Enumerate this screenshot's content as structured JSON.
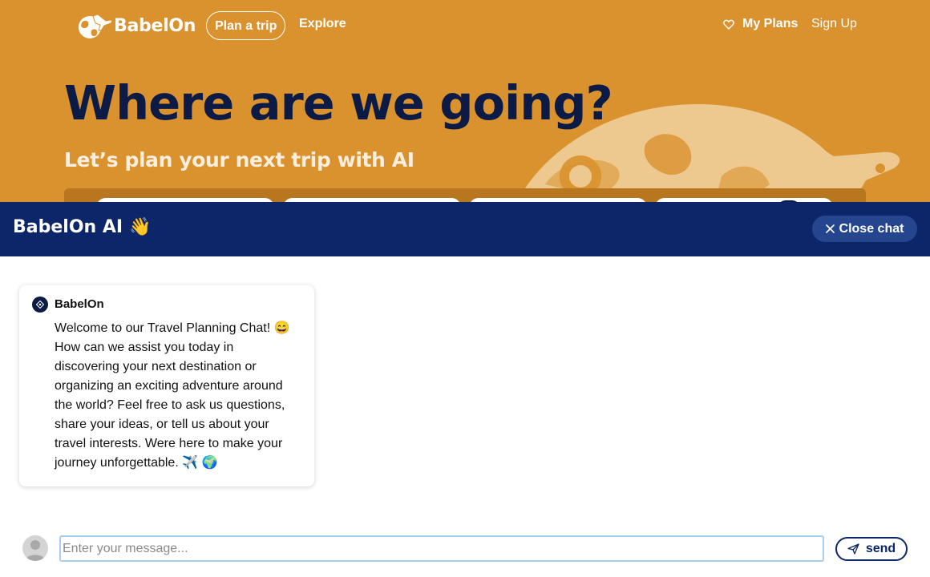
{
  "nav": {
    "brand": "BabelOn",
    "plan_trip": "Plan a trip",
    "explore": "Explore",
    "my_plans": "My Plans",
    "sign_up": "Sign Up"
  },
  "hero": {
    "title": "Where are we going?",
    "subtitle": "Let’s plan your next trip with AI"
  },
  "chat": {
    "title": "BabelOn AI",
    "title_emoji": "👋",
    "close_label": "Close chat",
    "messages": [
      {
        "sender": "BabelOn",
        "text": "Welcome to our Travel Planning Chat! 😄 How can we assist you today in discovering your next destination or organizing an exciting adventure around the world? Feel free to ask us questions, share your ideas, or tell us about your travel interests. Were here to make your journey unforgettable. ✈️ 🌍"
      }
    ],
    "input_placeholder": "Enter your message...",
    "send_label": "send"
  },
  "colors": {
    "hero_bg": "#d9922e",
    "navy": "#0c1b45",
    "chat_header_bg": "#0d2669",
    "close_button_bg": "#25458f",
    "input_border": "#a9cdef"
  },
  "icons": {
    "logo": "globe-plane-icon",
    "my_plans": "heart-icon",
    "close": "close-icon",
    "send": "send-icon",
    "user": "user-avatar-icon",
    "bot": "bot-avatar-icon"
  }
}
